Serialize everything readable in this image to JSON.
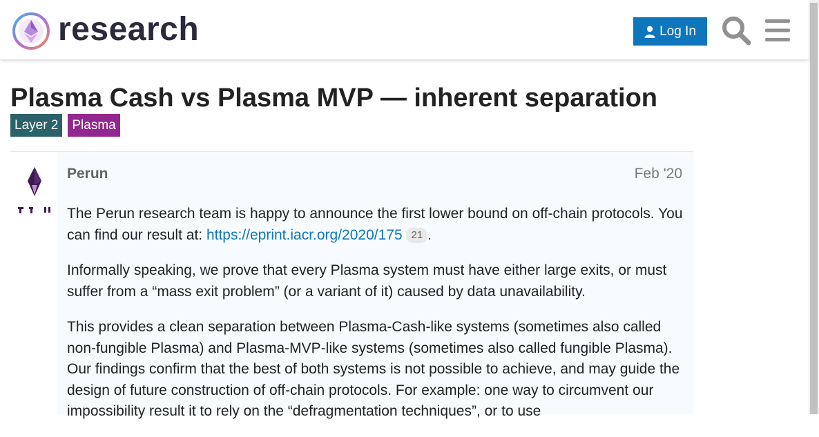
{
  "header": {
    "site_title": "research",
    "login_label": "Log In"
  },
  "topic": {
    "title": "Plasma Cash vs Plasma MVP — inherent separation",
    "tags": [
      {
        "label": "Layer 2",
        "color": "#2b6168"
      },
      {
        "label": "Plasma",
        "color": "#92278f"
      }
    ]
  },
  "post": {
    "author": "Perun",
    "date": "Feb '20",
    "p1_text": "The Perun research team is happy to announce the first lower bound on off-chain protocols. You can find our result at: ",
    "link_text": "https://eprint.iacr.org/2020/175",
    "link_clicks": "21",
    "p1_end": ".",
    "p2": "Informally speaking, we prove that every Plasma system must have either large exits, or must suffer from a “mass exit problem” (or a variant of it) caused by data unavailability.",
    "p3": "This provides a clean separation between Plasma-Cash-like systems (sometimes also called non-fungible Plasma) and Plasma-MVP-like systems (sometimes also called fungible Plasma). Our findings confirm that the best of both systems is not possible to achieve, and may guide the design of future construction of off-chain protocols. For example: one way to circumvent our impossibility result it to rely on the “defragmentation techniques”, or to use"
  },
  "colors": {
    "accent": "#0e76bd",
    "tag_layer2": "#2b6168",
    "tag_plasma": "#92278f"
  },
  "icons": {
    "logo": "ethereum-research-logo",
    "login": "user-icon",
    "search": "search-icon",
    "menu": "hamburger-icon",
    "avatar": "perun-avatar"
  }
}
